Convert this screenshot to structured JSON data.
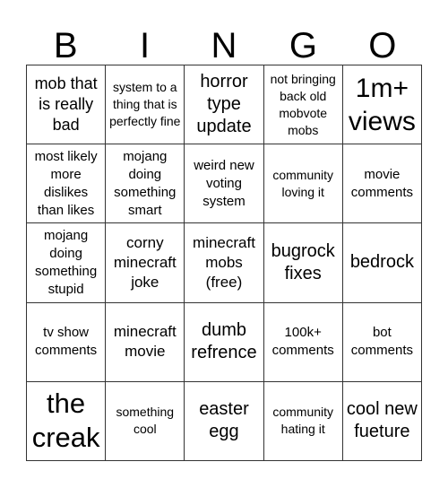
{
  "header": {
    "letters": [
      "B",
      "I",
      "N",
      "G",
      "O"
    ]
  },
  "board": {
    "rows": [
      [
        "mob that is really bad",
        "system to a thing that is perfectly fine",
        "horror type update",
        "not bringing back old mobvote mobs",
        "1m+ views"
      ],
      [
        "most likely more dislikes than likes",
        "mojang doing something smart",
        "weird new voting system",
        "community loving it",
        "movie comments"
      ],
      [
        "mojang doing something stupid",
        "corny minecraft joke",
        "minecraft mobs (free)",
        "bugrock fixes",
        "bedrock"
      ],
      [
        "tv show comments",
        "minecraft movie",
        "dumb refrence",
        "100k+ comments",
        "bot comments"
      ],
      [
        "the creak",
        "something cool",
        "easter egg",
        "community hating it",
        "cool new fueture"
      ]
    ]
  }
}
